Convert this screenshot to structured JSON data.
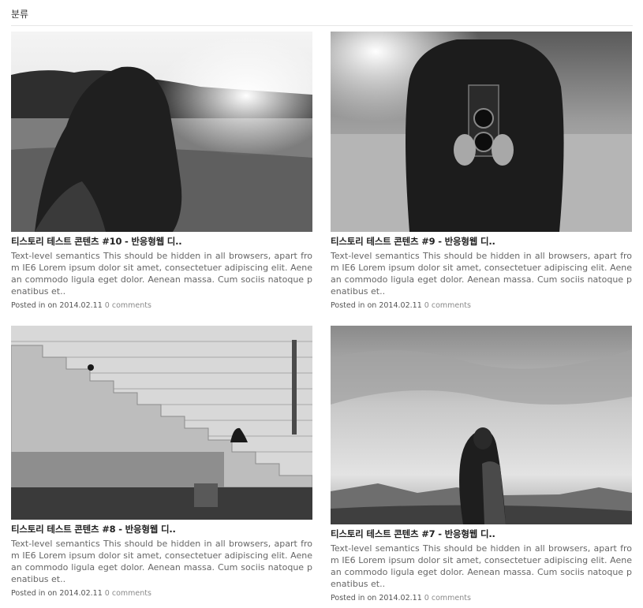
{
  "header": {
    "title": "분류"
  },
  "posts": [
    {
      "title": "티스토리 테스트 콘텐츠 #10 - 반응형웹 디..",
      "excerpt": "Text-level semantics This should be hidden in all browsers, apart from IE6 Lorem ipsum dolor sit amet, consectetuer adipiscing elit. Aenean commodo ligula eget dolor. Aenean massa. Cum sociis natoque penatibus et..",
      "posted_label": "Posted in",
      "on_label": "on",
      "date": "2014.02.11",
      "comments": "0 comments"
    },
    {
      "title": "티스토리 테스트 콘텐츠 #9 - 반응형웹 디..",
      "excerpt": "Text-level semantics This should be hidden in all browsers, apart from IE6 Lorem ipsum dolor sit amet, consectetuer adipiscing elit. Aenean commodo ligula eget dolor. Aenean massa. Cum sociis natoque penatibus et..",
      "posted_label": "Posted in",
      "on_label": "on",
      "date": "2014.02.11",
      "comments": "0 comments"
    },
    {
      "title": "티스토리 테스트 콘텐츠 #8 - 반응형웹 디..",
      "excerpt": "Text-level semantics This should be hidden in all browsers, apart from IE6 Lorem ipsum dolor sit amet, consectetuer adipiscing elit. Aenean commodo ligula eget dolor. Aenean massa. Cum sociis natoque penatibus et..",
      "posted_label": "Posted in",
      "on_label": "on",
      "date": "2014.02.11",
      "comments": "0 comments"
    },
    {
      "title": "티스토리 테스트 콘텐츠 #7 - 반응형웹 디..",
      "excerpt": "Text-level semantics This should be hidden in all browsers, apart from IE6 Lorem ipsum dolor sit amet, consectetuer adipiscing elit. Aenean commodo ligula eget dolor. Aenean massa. Cum sociis natoque penatibus et..",
      "posted_label": "Posted in",
      "on_label": "on",
      "date": "2014.02.11",
      "comments": "0 comments"
    }
  ]
}
